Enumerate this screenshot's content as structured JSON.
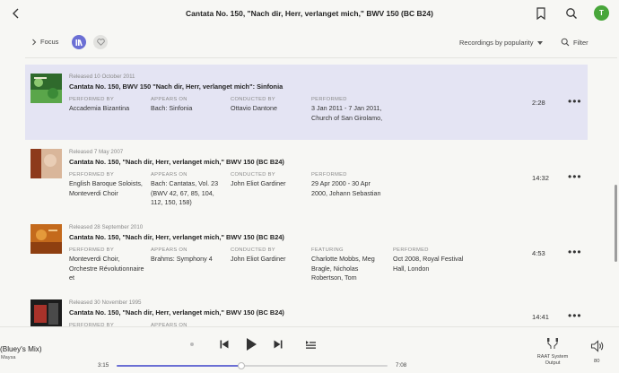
{
  "header": {
    "title": "Cantata No. 150, \"Nach dir, Herr, verlanget mich,\" BWV 150 (BC B24)",
    "avatar_initial": "T"
  },
  "toolbar": {
    "focus_label": "Focus",
    "sort_label": "Recordings by popularity",
    "filter_label": "Filter"
  },
  "labels": {
    "performed_by": "PERFORMED BY",
    "appears_on": "APPEARS ON",
    "conducted_by": "CONDUCTED BY",
    "performed": "PERFORMED",
    "featuring": "FEATURING"
  },
  "recordings": [
    {
      "released": "Released 10 October 2011",
      "title": "Cantata No. 150, BWV 150 \"Nach dir, Herr, verlanget mich\": Sinfonia",
      "performed_by": "Accademia Bizantina",
      "appears_on": "Bach: Sinfonia",
      "conducted_by": "Ottavio Dantone",
      "performed": "3 Jan 2011 - 7 Jan 2011, Church of San Girolamo,",
      "duration": "2:28",
      "selected": true
    },
    {
      "released": "Released 7 May 2007",
      "title": "Cantata No. 150, \"Nach dir, Herr, verlanget mich,\" BWV 150 (BC B24)",
      "performed_by": "English Baroque Soloists, Monteverdi Choir",
      "appears_on": "Bach: Cantatas, Vol. 23  (BWV 42, 67, 85, 104, 112, 150, 158)",
      "conducted_by": "John Eliot Gardiner",
      "performed": "29 Apr 2000 - 30 Apr 2000, Johann Sebastian",
      "duration": "14:32"
    },
    {
      "released": "Released 28 September 2010",
      "title": "Cantata No. 150, \"Nach dir, Herr, verlanget mich,\" BWV 150 (BC B24)",
      "performed_by": "Monteverdi Choir, Orchestre Révolutionnaire et",
      "appears_on": "Brahms: Symphony 4",
      "conducted_by": "John Eliot Gardiner",
      "featuring": "Charlotte Mobbs, Meg Bragle, Nicholas Robertson, Tom",
      "performed": "Oct 2008, Royal Festival Hall, London",
      "duration": "4:53"
    },
    {
      "released": "Released 30 November 1995",
      "title": "Cantata No. 150, \"Nach dir, Herr, verlanget mich,\" BWV 150 (BC B24)",
      "performed_by": "",
      "appears_on": "",
      "duration": "14:41"
    }
  ],
  "player": {
    "track_title": "(Bluey's Mix)",
    "artist": "Maysa",
    "elapsed": "3:15",
    "total": "7:08",
    "progress_fraction": 0.46,
    "zone_label": "RAAT System Output",
    "volume": "80"
  },
  "colors": {
    "accent": "#6b6fd4",
    "selected_row": "#e4e4f3",
    "avatar": "#48a63a",
    "background": "#f7f7f4"
  },
  "icons": {
    "back": "chevron-left-icon",
    "bookmark": "bookmark-icon",
    "search": "search-icon",
    "library": "library-icon",
    "favorite": "heart-icon",
    "more": "more-horizontal-icon",
    "prev": "skip-previous-icon",
    "play": "play-icon",
    "next": "skip-next-icon",
    "queue": "queue-icon",
    "zone": "speaker-zone-icon",
    "volume": "volume-icon"
  }
}
